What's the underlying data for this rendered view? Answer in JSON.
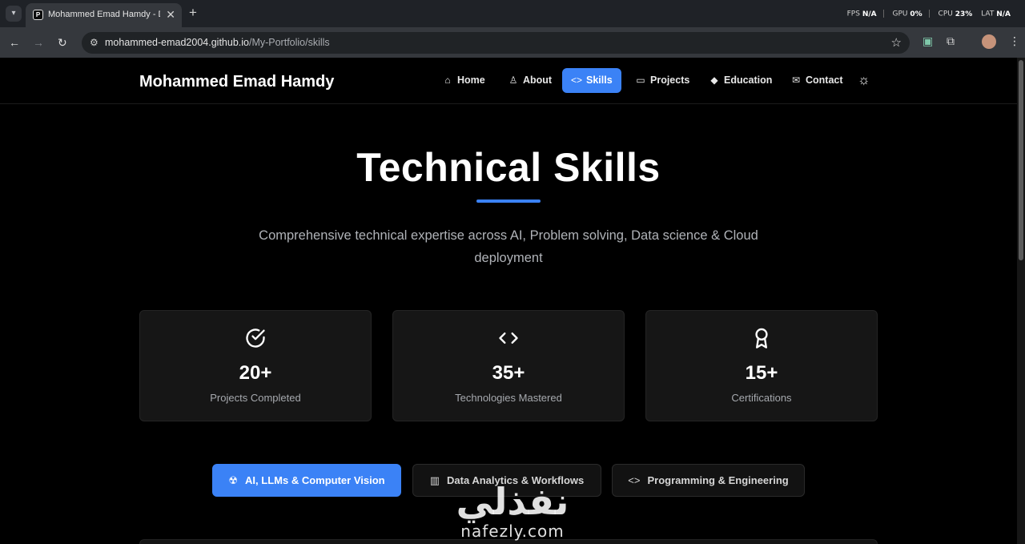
{
  "browser": {
    "tab_title": "Mohammed Emad Hamdy - Da",
    "tab_favicon_letter": "P",
    "url_host": "mohammed-emad2004.github.io",
    "url_path": "/My-Portfolio/skills",
    "perf": {
      "fps_label": "FPS",
      "fps_value": "N/A",
      "gpu_label": "GPU",
      "gpu_value": "0%",
      "cpu_label": "CPU",
      "cpu_value": "23%",
      "lat_label": "LAT",
      "lat_value": "N/A"
    }
  },
  "site": {
    "brand": "Mohammed Emad Hamdy",
    "nav": [
      {
        "label": "Home",
        "icon": "home-icon",
        "active": false
      },
      {
        "label": "About",
        "icon": "user-icon",
        "active": false
      },
      {
        "label": "Skills",
        "icon": "code-icon",
        "active": true
      },
      {
        "label": "Projects",
        "icon": "folder-icon",
        "active": false
      },
      {
        "label": "Education",
        "icon": "graduation-cap-icon",
        "active": false
      },
      {
        "label": "Contact",
        "icon": "mail-icon",
        "active": false
      }
    ],
    "theme_toggle_icon": "sun-icon"
  },
  "hero": {
    "title": "Technical Skills",
    "subtitle": "Comprehensive technical expertise across AI, Problem solving, Data science & Cloud deployment"
  },
  "stats": [
    {
      "value": "20+",
      "label": "Projects Completed",
      "icon": "check-circle-icon"
    },
    {
      "value": "35+",
      "label": "Technologies Mastered",
      "icon": "code-icon"
    },
    {
      "value": "15+",
      "label": "Certifications",
      "icon": "award-icon"
    }
  ],
  "categories": [
    {
      "label": "AI, LLMs & Computer Vision",
      "icon": "brain-icon",
      "active": true
    },
    {
      "label": "Data Analytics & Workflows",
      "icon": "bar-chart-icon",
      "active": false
    },
    {
      "label": "Programming & Engineering",
      "icon": "code-icon",
      "active": false
    }
  ],
  "watermark": {
    "arabic": "نفذلي",
    "latin": "nafezly.com"
  },
  "colors": {
    "accent": "#3b82f6",
    "background": "#000000",
    "card": "#161616"
  }
}
